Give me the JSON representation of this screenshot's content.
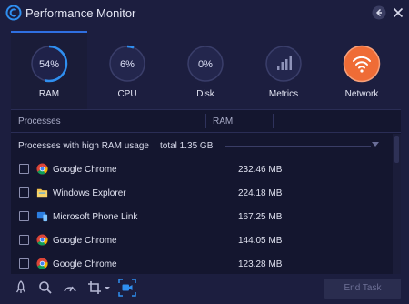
{
  "app": {
    "title": "Performance Monitor"
  },
  "tabs": [
    {
      "label": "RAM",
      "value_text": "54%",
      "percent": 54,
      "color": "#2f8ff0",
      "active": true
    },
    {
      "label": "CPU",
      "value_text": "6%",
      "percent": 6,
      "color": "#2f8ff0"
    },
    {
      "label": "Disk",
      "value_text": "0%",
      "percent": 0,
      "color": "#2f8ff0"
    },
    {
      "label": "Metrics",
      "icon": "bar-chart-icon"
    },
    {
      "label": "Network",
      "icon": "wifi-icon",
      "color": "#ef6c36"
    }
  ],
  "table": {
    "col_processes": "Processes",
    "col_ram": "RAM",
    "group_label": "Processes with high RAM usage",
    "group_total": "total 1.35 GB",
    "rows": [
      {
        "name": "Google Chrome",
        "ram": "232.46 MB",
        "icon": "chrome-icon"
      },
      {
        "name": "Windows Explorer",
        "ram": "224.18 MB",
        "icon": "folder-icon"
      },
      {
        "name": "Microsoft Phone Link",
        "ram": "167.25 MB",
        "icon": "phone-link-icon"
      },
      {
        "name": "Google Chrome",
        "ram": "144.05 MB",
        "icon": "chrome-icon"
      },
      {
        "name": "Google Chrome",
        "ram": "123.28 MB",
        "icon": "chrome-icon"
      }
    ]
  },
  "footer": {
    "end_task_label": "End Task"
  },
  "colors": {
    "accent": "#2f8ff0",
    "network": "#ef6c36",
    "background": "#1c1e3f"
  }
}
